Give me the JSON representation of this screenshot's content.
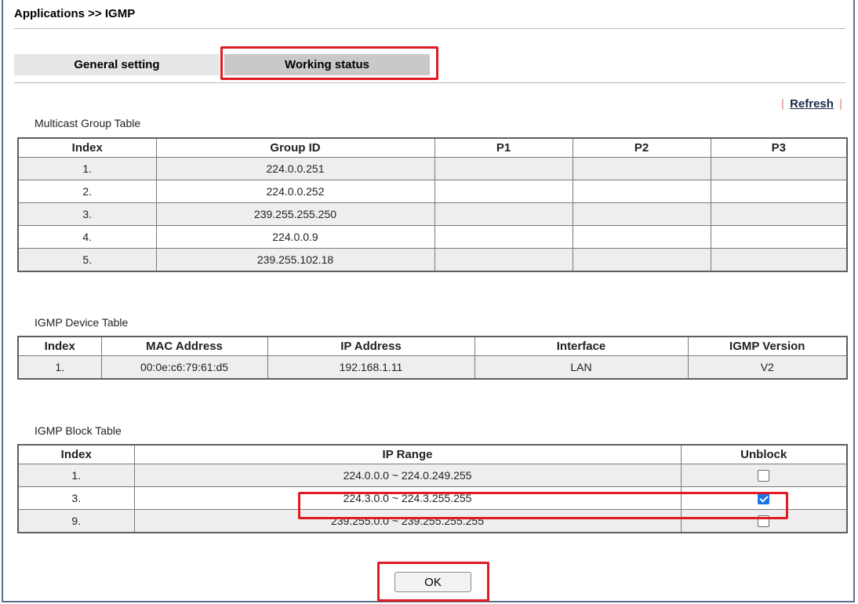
{
  "breadcrumb": "Applications >> IGMP",
  "tabs": {
    "general": "General setting",
    "working": "Working status"
  },
  "refresh": {
    "pipe_left": "|",
    "label": "Refresh",
    "pipe_right": "|"
  },
  "multicast": {
    "caption": "Multicast Group Table",
    "headers": [
      "Index",
      "Group ID",
      "P1",
      "P2",
      "P3"
    ],
    "rows": [
      [
        "1.",
        "224.0.0.251",
        "",
        "",
        ""
      ],
      [
        "2.",
        "224.0.0.252",
        "",
        "",
        ""
      ],
      [
        "3.",
        "239.255.255.250",
        "",
        "",
        ""
      ],
      [
        "4.",
        "224.0.0.9",
        "",
        "",
        ""
      ],
      [
        "5.",
        "239.255.102.18",
        "",
        "",
        ""
      ]
    ]
  },
  "device": {
    "caption": "IGMP Device Table",
    "headers": [
      "Index",
      "MAC Address",
      "IP Address",
      "Interface",
      "IGMP Version"
    ],
    "rows": [
      [
        "1.",
        "00:0e:c6:79:61:d5",
        "192.168.1.11",
        "LAN",
        "V2"
      ]
    ]
  },
  "block": {
    "caption": "IGMP Block Table",
    "headers": [
      "Index",
      "IP Range",
      "Unblock"
    ],
    "rows": [
      {
        "index": "1.",
        "range": "224.0.0.0 ~ 224.0.249.255",
        "unblock": false
      },
      {
        "index": "3.",
        "range": "224.3.0.0 ~ 224.3.255.255",
        "unblock": true
      },
      {
        "index": "9.",
        "range": "239.255.0.0 ~ 239.255.255.255",
        "unblock": false
      }
    ]
  },
  "ok_label": "OK",
  "colors": {
    "highlight": "#e11b22",
    "frame": "#5a6f8c",
    "row_shade": "#eeeeee",
    "checkbox_checked": "#1a73e8"
  }
}
